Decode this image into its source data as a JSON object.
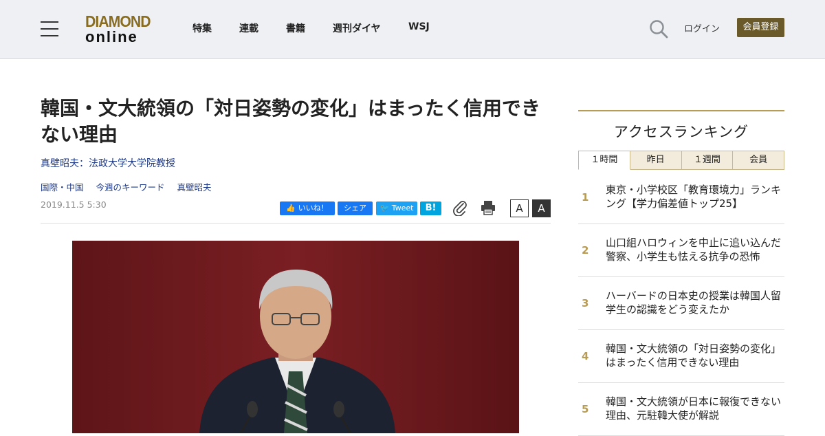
{
  "header": {
    "logo_top": "DIAMOND",
    "logo_bottom": "online",
    "nav": [
      "特集",
      "連載",
      "書籍",
      "週刊ダイヤ",
      "WSJ"
    ],
    "login": "ログイン",
    "register": "会員登録"
  },
  "article": {
    "title": "韓国・文大統領の「対日姿勢の変化」はまったく信用できない理由",
    "author": "真壁昭夫：法政大学大学院教授",
    "tags": [
      "国際・中国",
      "今週のキーワード",
      "真壁昭夫"
    ],
    "date": "2019.11.5 5:30",
    "share": {
      "like": "いいね！",
      "share": "シェア",
      "tweet": "Tweet",
      "hatena": "B!"
    },
    "font_small": "A",
    "font_large": "A"
  },
  "sidebar": {
    "title": "アクセスランキング",
    "tabs": [
      "１時間",
      "昨日",
      "１週間",
      "会員"
    ],
    "active_tab": "１時間",
    "ranking": [
      {
        "num": "1",
        "text": "東京・小学校区「教育環境力」ランキング【学力偏差値トップ25】"
      },
      {
        "num": "2",
        "text": "山口組ハロウィンを中止に追い込んだ警察、小学生も怯える抗争の恐怖"
      },
      {
        "num": "3",
        "text": "ハーバードの日本史の授業は韓国人留学生の認識をどう変えたか"
      },
      {
        "num": "4",
        "text": "韓国・文大統領の「対日姿勢の変化」はまったく信用できない理由"
      },
      {
        "num": "5",
        "text": "韓国・文大統領が日本に報復できない理由、元駐韓大使が解説"
      }
    ]
  },
  "colors": {
    "header_bg": "#eef0f3",
    "logo_gold": "#8a6d1f",
    "register_bg": "#6a5a2a",
    "link_blue": "#1e3a8a",
    "sidebar_accent": "#b89b54",
    "photo_curtain": "#6e1a1e"
  }
}
